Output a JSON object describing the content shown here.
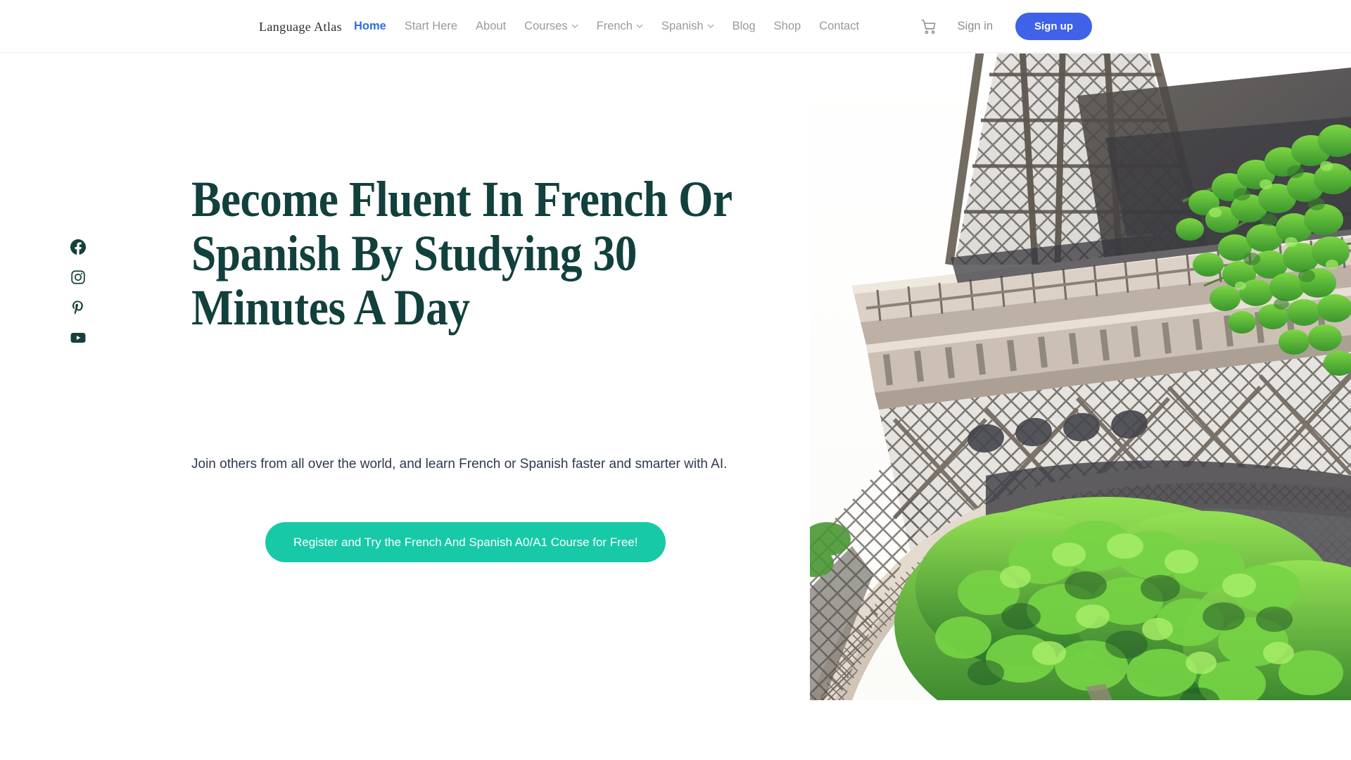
{
  "nav": {
    "logo": "Language Atlas",
    "links": [
      {
        "label": "Home",
        "active": true,
        "caret": false
      },
      {
        "label": "Start Here",
        "active": false,
        "caret": false
      },
      {
        "label": "About",
        "active": false,
        "caret": false
      },
      {
        "label": "Courses",
        "active": false,
        "caret": true
      },
      {
        "label": "French",
        "active": false,
        "caret": true
      },
      {
        "label": "Spanish",
        "active": false,
        "caret": true
      },
      {
        "label": "Blog",
        "active": false,
        "caret": false
      },
      {
        "label": "Shop",
        "active": false,
        "caret": false
      },
      {
        "label": "Contact",
        "active": false,
        "caret": false
      }
    ],
    "cart_icon": "shopping-cart-icon",
    "signin_label": "Sign in",
    "signup_label": "Sign up",
    "active_link_color": "#2f6fe4",
    "signup_bg_color": "#3f62e8"
  },
  "social": {
    "items": [
      {
        "name": "facebook-icon",
        "label": "Facebook"
      },
      {
        "name": "instagram-icon",
        "label": "Instagram"
      },
      {
        "name": "pinterest-icon",
        "label": "Pinterest"
      },
      {
        "name": "youtube-icon",
        "label": "YouTube"
      }
    ],
    "color": "#15403c"
  },
  "hero": {
    "title": "Become Fluent In French Or Spanish By Studying 30 Minutes A Day",
    "subtitle": "Join others from all over the world, and learn French or Spanish faster and smarter with AI.",
    "cta_label": "Register and Try the French And Spanish A0/A1 Course for Free!",
    "title_color": "#12403c",
    "cta_bg_color": "#17c9a7",
    "image_alt": "eiffel-tower-photo"
  }
}
